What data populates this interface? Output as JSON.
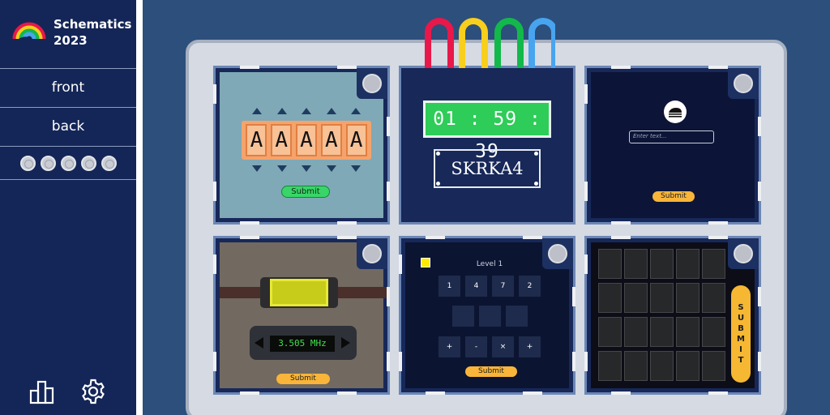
{
  "app": {
    "brand_line1": "Schematics",
    "brand_line2": "2023"
  },
  "nav": {
    "front": "front",
    "back": "back"
  },
  "strikes": {
    "count": 5,
    "icon": "bolt-icon"
  },
  "bottom_icons": {
    "stats": "bar-chart-icon",
    "settings": "gear-icon"
  },
  "colors": {
    "wire_colors": [
      "#e8184a",
      "#f7cf1c",
      "#13b84a",
      "#48a4ef"
    ],
    "sidebar": "#142657",
    "background": "#2c4f7c"
  },
  "letter_module": {
    "letters": [
      "A",
      "A",
      "A",
      "A",
      "A"
    ],
    "submit": "Submit"
  },
  "timer_module": {
    "time": "01 : 59 : 39",
    "serial": "SKRKA4"
  },
  "text_module": {
    "placeholder": "Enter text...",
    "submit": "Submit"
  },
  "frequency_module": {
    "frequency": "3.505 MHz",
    "submit": "Submit"
  },
  "math_module": {
    "level": "Level 1",
    "numbers": [
      "1",
      "4",
      "7",
      "2"
    ],
    "operators": [
      "+",
      "-",
      "×",
      "+"
    ],
    "submit": "Submit"
  },
  "grid_module": {
    "submit_letters": [
      "S",
      "U",
      "B",
      "M",
      "I",
      "T"
    ]
  }
}
